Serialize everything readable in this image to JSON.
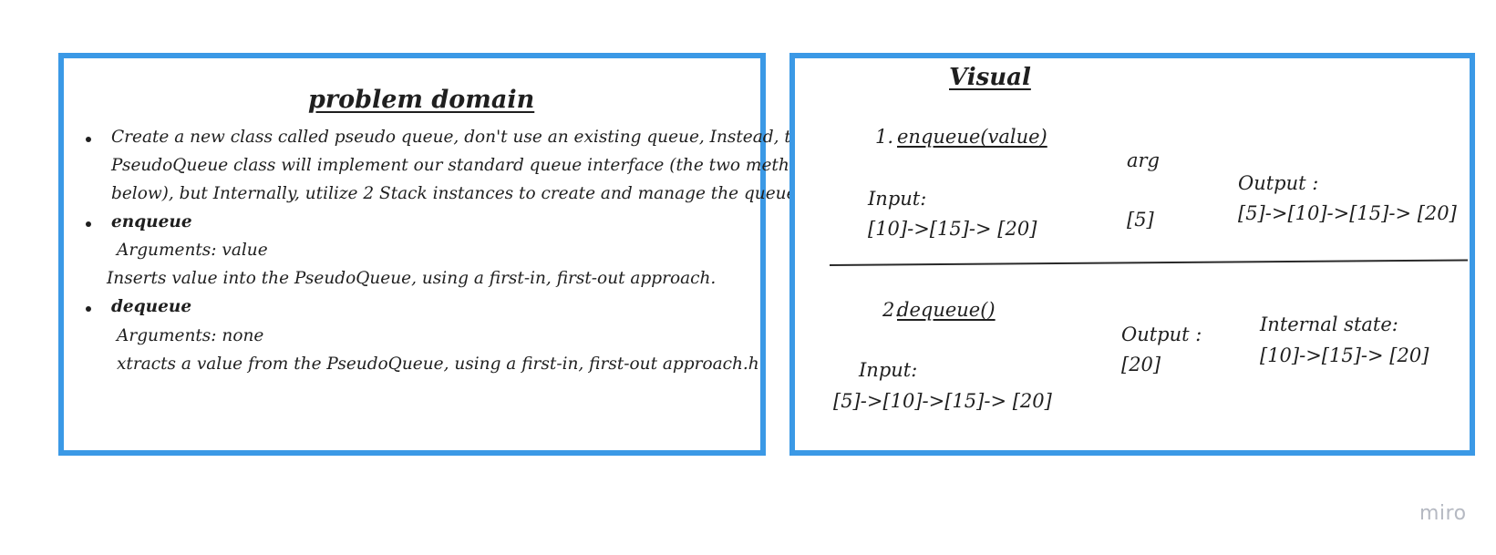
{
  "problem_domain": {
    "title": "problem domain",
    "description_lines": [
      "Create a new class called pseudo queue, don't use an existing queue, Instead, this",
      "PseudoQueue class will implement our standard queue interface (the two methods listed",
      "below), but Internally, utilize 2 Stack instances to create and manage the queue."
    ],
    "enqueue": {
      "name": "enqueue",
      "arguments": "Arguments: value",
      "description": "Inserts value into the PseudoQueue, using a first-in, first-out approach."
    },
    "dequeue": {
      "name": "dequeue",
      "arguments": "Arguments: none",
      "description": "xtracts a value from the PseudoQueue, using a first-in, first-out approach.h"
    }
  },
  "visual": {
    "title": "Visual",
    "enqueue": {
      "number": "1.",
      "label": "enqueue(value)",
      "arg_label": "arg",
      "arg_value": "[5]",
      "input_label": "Input:",
      "input_value": "[10]->[15]-> [20]",
      "output_label": "Output :",
      "output_value": "[5]->[10]->[15]-> [20]"
    },
    "dequeue": {
      "number": "2.",
      "label": "dequeue()",
      "input_label": "Input:",
      "input_value": "[5]->[10]->[15]-> [20]",
      "output_label": "Output :",
      "output_value": "[20]",
      "state_label": "Internal state:",
      "state_value": "[10]->[15]-> [20]"
    }
  },
  "watermark": "miro",
  "colors": {
    "frame_border": "#3b99e6",
    "watermark": "#b5b9c2"
  }
}
